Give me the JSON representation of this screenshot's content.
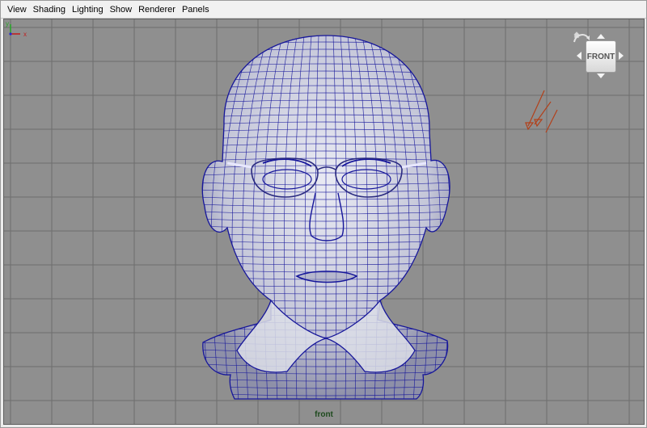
{
  "menubar": {
    "items": [
      "View",
      "Shading",
      "Lighting",
      "Show",
      "Renderer",
      "Panels"
    ]
  },
  "viewport": {
    "camera_label": "front",
    "background_color": "#8f8f8f",
    "grid_color": "#6e6e6e",
    "wire_color": "#16169a",
    "mesh_color": "#d4d6e6"
  },
  "viewcube": {
    "face_label": "FRONT"
  },
  "axis": {
    "y_label": "y",
    "x_label": "x",
    "y_color": "#2aa52a",
    "x_color": "#c02020",
    "z_color": "#2a2ad0"
  },
  "icons": {
    "home": "home-icon",
    "rotate": "rotate-icon",
    "light_locator": "light-locator-icon"
  }
}
